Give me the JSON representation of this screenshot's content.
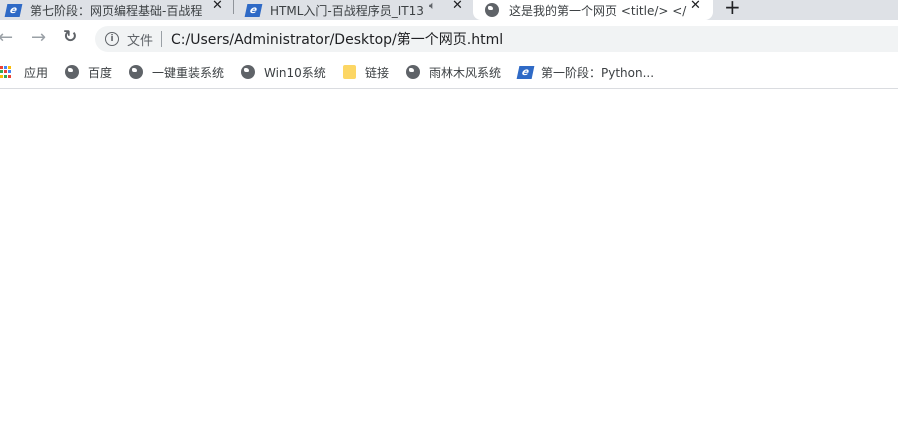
{
  "tabs": [
    {
      "title": "第七阶段：网页编程基础-百战程",
      "icon": "blue-e-icon",
      "active": false
    },
    {
      "title": "HTML入门-百战程序员_IT13",
      "icon": "blue-e-icon",
      "active": false,
      "audio_icon": "speaker-icon"
    },
    {
      "title": "这是我的第一个网页 <title/> </",
      "icon": "globe-icon",
      "active": true
    }
  ],
  "tab_close_glyph": "✕",
  "new_tab_glyph": "+",
  "toolbar": {
    "back_glyph": "←",
    "forward_glyph": "→",
    "reload_glyph": "↻"
  },
  "omnibox": {
    "info_glyph": "i",
    "scheme_label": "文件",
    "url": "C:/Users/Administrator/Desktop/第一个网页.html"
  },
  "bookmarks": [
    {
      "label": "应用",
      "icon": "apps-grid-icon"
    },
    {
      "label": "百度",
      "icon": "globe-icon"
    },
    {
      "label": "一键重装系统",
      "icon": "globe-icon"
    },
    {
      "label": "Win10系统",
      "icon": "globe-icon"
    },
    {
      "label": "链接",
      "icon": "folder-icon"
    },
    {
      "label": "雨林木风系统",
      "icon": "globe-icon"
    },
    {
      "label": "第一阶段：Python...",
      "icon": "blue-e-icon"
    }
  ],
  "colors": {
    "tabstrip_bg": "#dee1e6",
    "active_tab_bg": "#ffffff",
    "omnibox_bg": "#f1f3f4",
    "brand_blue": "#2f6ac6",
    "folder_yellow": "#fcd664"
  }
}
